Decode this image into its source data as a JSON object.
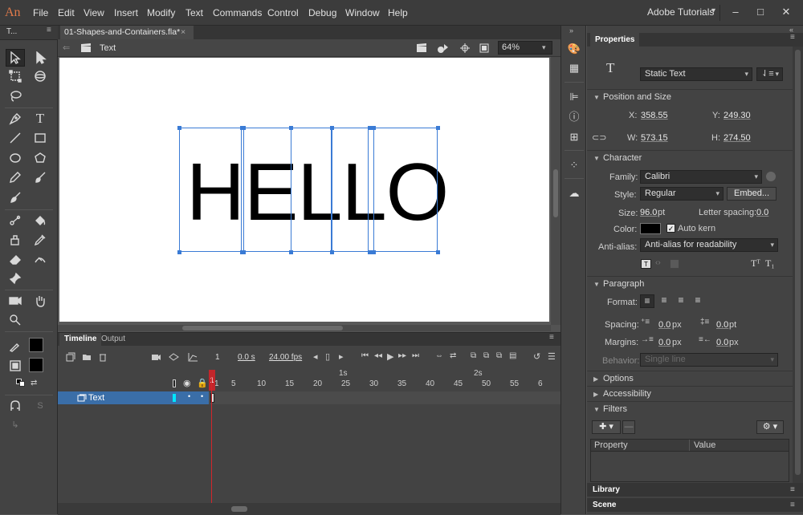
{
  "app": {
    "logo": "An",
    "workspace": "Adobe Tutorials"
  },
  "menu": [
    "File",
    "Edit",
    "View",
    "Insert",
    "Modify",
    "Text",
    "Commands",
    "Control",
    "Debug",
    "Window",
    "Help"
  ],
  "tools_header": "T...",
  "document": {
    "tab_title": "01-Shapes-and-Containers.fla*",
    "tab_close": "×",
    "scene": "Text",
    "zoom": "64%"
  },
  "stage": {
    "text": "HELLO"
  },
  "timeline": {
    "tabs": {
      "timeline": "Timeline",
      "output": "Output"
    },
    "frame": "1",
    "time": "0.0 s",
    "fps": "24.00 fps",
    "ruler_seconds": {
      "s1": "1s",
      "s2": "2s"
    },
    "ruler": [
      "1",
      "5",
      "10",
      "15",
      "20",
      "25",
      "30",
      "35",
      "40",
      "45",
      "50",
      "55",
      "6"
    ],
    "layer_name": "Text"
  },
  "properties": {
    "tab": "Properties",
    "text_type": "Static Text",
    "position_size": {
      "header": "Position and Size",
      "x_label": "X:",
      "x": "358.55",
      "y_label": "Y:",
      "y": "249.30",
      "w_label": "W:",
      "w": "573.15",
      "h_label": "H:",
      "h": "274.50"
    },
    "character": {
      "header": "Character",
      "family_label": "Family:",
      "family": "Calibri",
      "style_label": "Style:",
      "style": "Regular",
      "embed": "Embed...",
      "size_label": "Size:",
      "size": "96.0",
      "size_unit": "pt",
      "letter_spacing_label": "Letter spacing:",
      "letter_spacing": "0.0",
      "color_label": "Color:",
      "color": "#000000",
      "auto_kern": "Auto kern",
      "anti_alias_label": "Anti-alias:",
      "anti_alias": "Anti-alias for readability"
    },
    "paragraph": {
      "header": "Paragraph",
      "format_label": "Format:",
      "spacing_label": "Spacing:",
      "spacing_indent": "0.0",
      "spacing_line": "0.0",
      "margins_label": "Margins:",
      "margin_left": "0.0",
      "margin_right": "0.0",
      "unit_px": "px",
      "unit_pt": "pt",
      "behavior_label": "Behavior:",
      "behavior": "Single line"
    },
    "options": "Options",
    "accessibility": "Accessibility",
    "filters": {
      "header": "Filters",
      "col_property": "Property",
      "col_value": "Value"
    }
  },
  "footer": {
    "library": "Library",
    "scene": "Scene"
  },
  "colors": {
    "accent": "#3a7bd5",
    "playhead": "#c3262b",
    "layer_select": "#3a6ea8"
  }
}
